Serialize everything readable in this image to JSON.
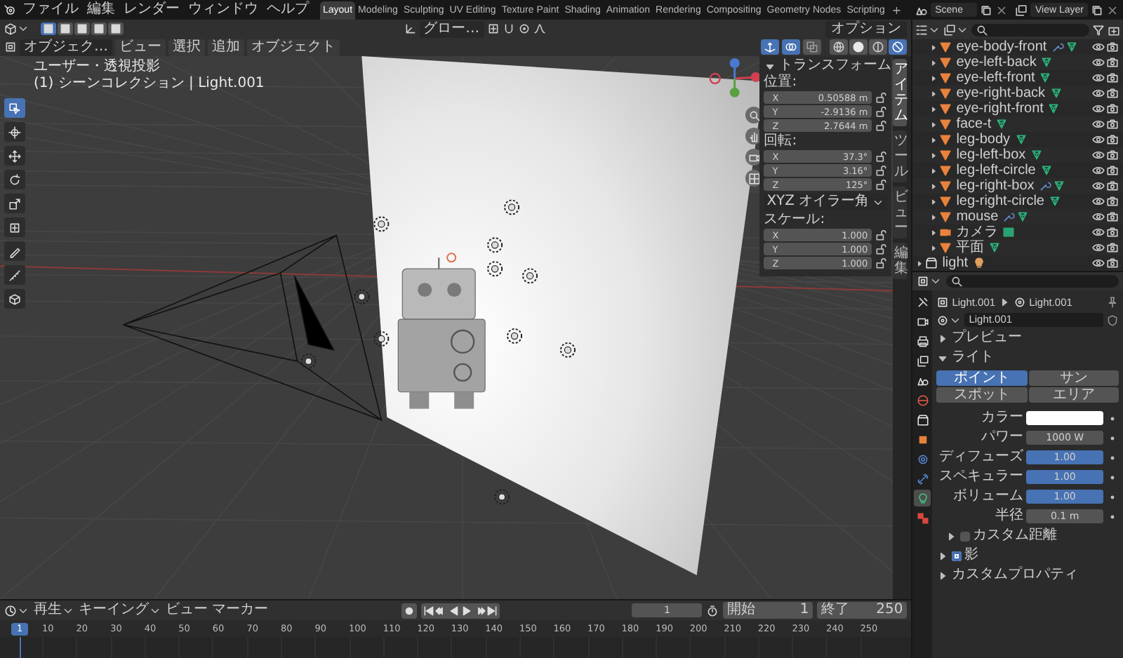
{
  "topbar": {
    "menus": [
      "ファイル",
      "編集",
      "レンダー",
      "ウィンドウ",
      "ヘルプ"
    ],
    "workspaces": [
      {
        "label": "Layout",
        "selected": true
      },
      {
        "label": "Modeling",
        "selected": false
      },
      {
        "label": "Sculpting",
        "selected": false
      },
      {
        "label": "UV Editing",
        "selected": false
      },
      {
        "label": "Texture Paint",
        "selected": false
      },
      {
        "label": "Shading",
        "selected": false
      },
      {
        "label": "Animation",
        "selected": false
      },
      {
        "label": "Rendering",
        "selected": false
      },
      {
        "label": "Compositing",
        "selected": false
      },
      {
        "label": "Geometry Nodes",
        "selected": false
      },
      {
        "label": "Scripting",
        "selected": false
      }
    ],
    "add_workspace": "+",
    "scene": "Scene",
    "view_layer": "View Layer"
  },
  "viewport": {
    "select_modes": [
      {
        "selected": true
      },
      {
        "selected": false
      },
      {
        "selected": false
      },
      {
        "selected": false
      },
      {
        "selected": false
      }
    ],
    "orientation": "グロー…",
    "options": "オプション",
    "mode": "オブジェク…",
    "menus": [
      "ビュー",
      "選択",
      "追加",
      "オブジェクト"
    ],
    "toggles": [
      {
        "kind": "gizmo",
        "on": true
      },
      {
        "kind": "overlay",
        "on": true
      },
      {
        "kind": "xray",
        "on": false
      }
    ],
    "shading": [
      {
        "kind": "wireframe",
        "selected": false
      },
      {
        "kind": "solid",
        "selected": false
      },
      {
        "kind": "material",
        "selected": false
      },
      {
        "kind": "rendered",
        "selected": true
      }
    ],
    "view_name": "ユーザー・透視投影",
    "context": "(1) シーンコレクション | Light.001",
    "tools": [
      {
        "kind": "select",
        "selected": true
      },
      {
        "kind": "cursor",
        "selected": false
      },
      {
        "kind": "move",
        "selected": false
      },
      {
        "kind": "rotate",
        "selected": false
      },
      {
        "kind": "scale",
        "selected": false
      },
      {
        "kind": "transform",
        "selected": false
      },
      {
        "kind": "annotate",
        "selected": false
      },
      {
        "kind": "measure",
        "selected": false
      },
      {
        "kind": "add-cube",
        "selected": false
      }
    ],
    "sidebar_tabs": [
      {
        "label": "アイテム",
        "selected": true
      },
      {
        "label": "ツール",
        "selected": false
      },
      {
        "label": "ビュー",
        "selected": false
      },
      {
        "label": "編集",
        "selected": false
      }
    ],
    "transform": {
      "title": "トランスフォーム",
      "groups": [
        {
          "label": "位置:",
          "fields": [
            {
              "axis": "X",
              "value": "0.50588 m"
            },
            {
              "axis": "Y",
              "value": "-2.9136 m"
            },
            {
              "axis": "Z",
              "value": "2.7644 m"
            }
          ]
        },
        {
          "label": "回転:",
          "fields": [
            {
              "axis": "X",
              "value": "37.3°"
            },
            {
              "axis": "Y",
              "value": "3.16°"
            },
            {
              "axis": "Z",
              "value": "125°"
            }
          ],
          "mode": "XYZ オイラー角"
        },
        {
          "label": "スケール:",
          "fields": [
            {
              "axis": "X",
              "value": "1.000"
            },
            {
              "axis": "Y",
              "value": "1.000"
            },
            {
              "axis": "Z",
              "value": "1.000"
            }
          ]
        }
      ]
    }
  },
  "outliner": {
    "items": [
      {
        "name": "eye-body-front",
        "kind": "mesh",
        "modifier": true,
        "expanded": false
      },
      {
        "name": "eye-left-back",
        "kind": "mesh",
        "modifier": false,
        "expanded": false
      },
      {
        "name": "eye-left-front",
        "kind": "mesh",
        "modifier": false,
        "expanded": false
      },
      {
        "name": "eye-right-back",
        "kind": "mesh",
        "modifier": false,
        "expanded": false
      },
      {
        "name": "eye-right-front",
        "kind": "mesh",
        "modifier": false,
        "expanded": false
      },
      {
        "name": "face-t",
        "kind": "mesh",
        "modifier": false,
        "expanded": false
      },
      {
        "name": "leg-body",
        "kind": "mesh",
        "modifier": false,
        "expanded": false
      },
      {
        "name": "leg-left-box",
        "kind": "mesh",
        "modifier": false,
        "expanded": false
      },
      {
        "name": "leg-left-circle",
        "kind": "mesh",
        "modifier": false,
        "expanded": false
      },
      {
        "name": "leg-right-box",
        "kind": "mesh",
        "modifier": true,
        "expanded": false
      },
      {
        "name": "leg-right-circle",
        "kind": "mesh",
        "modifier": false,
        "expanded": false
      },
      {
        "name": "mouse",
        "kind": "mesh",
        "modifier": true,
        "expanded": false
      },
      {
        "name": "カメラ",
        "kind": "camera",
        "modifier": false,
        "expanded": false
      },
      {
        "name": "平面",
        "kind": "mesh",
        "modifier": false,
        "expanded": false
      }
    ],
    "next_collection": {
      "name": "light",
      "expanded": false
    }
  },
  "properties": {
    "tabs": [
      {
        "kind": "tool",
        "selected": false
      },
      {
        "kind": "render",
        "selected": false
      },
      {
        "kind": "output",
        "selected": false
      },
      {
        "kind": "view-layer",
        "selected": false
      },
      {
        "kind": "scene",
        "selected": false
      },
      {
        "kind": "world",
        "selected": false
      },
      {
        "kind": "collection",
        "selected": false
      },
      {
        "kind": "object",
        "selected": false
      },
      {
        "kind": "physics",
        "selected": false
      },
      {
        "kind": "constraints",
        "selected": false
      },
      {
        "kind": "light-data",
        "selected": true
      },
      {
        "kind": "texture",
        "selected": false
      }
    ],
    "breadcrumb": [
      "Light.001",
      "Light.001"
    ],
    "datablock": "Light.001",
    "preview": {
      "title": "プレビュー",
      "expanded": false
    },
    "light": {
      "title": "ライト",
      "expanded": true,
      "types": [
        {
          "label": "ポイント",
          "selected": true
        },
        {
          "label": "サン",
          "selected": false
        },
        {
          "label": "スポット",
          "selected": false
        },
        {
          "label": "エリア",
          "selected": false
        }
      ],
      "fields": [
        {
          "kind": "color",
          "label": "カラー",
          "color": "#ffffff"
        },
        {
          "kind": "number",
          "label": "パワー",
          "value": "1000 W"
        },
        {
          "kind": "slider",
          "label": "ディフューズ",
          "value": "1.00",
          "level": 1
        },
        {
          "kind": "slider",
          "label": "スペキュラー",
          "value": "1.00",
          "level": 1
        },
        {
          "kind": "slider",
          "label": "ボリューム",
          "value": "1.00",
          "level": 1
        },
        {
          "kind": "number",
          "label": "半径",
          "value": "0.1 m"
        }
      ],
      "custom_distance": {
        "label": "カスタム距離",
        "checked": false,
        "expanded": false
      }
    },
    "shadow": {
      "label": "影",
      "checked": true,
      "expanded": false
    },
    "custom_properties": {
      "title": "カスタムプロパティ",
      "expanded": false
    }
  },
  "timeline": {
    "menus": [
      {
        "label": "再生",
        "dropdown": true
      },
      {
        "label": "キーイング",
        "dropdown": true
      },
      {
        "label": "ビュー",
        "dropdown": false
      },
      {
        "label": "マーカー",
        "dropdown": false
      }
    ],
    "current_frame": "1",
    "start_label": "開始",
    "start": "1",
    "end_label": "終了",
    "end": "250",
    "ruler": [
      {
        "label": "1",
        "selected": true
      },
      {
        "label": "10",
        "selected": false
      },
      {
        "label": "20",
        "selected": false
      },
      {
        "label": "30",
        "selected": false
      },
      {
        "label": "40",
        "selected": false
      },
      {
        "label": "50",
        "selected": false
      },
      {
        "label": "60",
        "selected": false
      },
      {
        "label": "70",
        "selected": false
      },
      {
        "label": "80",
        "selected": false
      },
      {
        "label": "90",
        "selected": false
      },
      {
        "label": "100",
        "selected": false
      },
      {
        "label": "110",
        "selected": false
      },
      {
        "label": "120",
        "selected": false
      },
      {
        "label": "130",
        "selected": false
      },
      {
        "label": "140",
        "selected": false
      },
      {
        "label": "150",
        "selected": false
      },
      {
        "label": "160",
        "selected": false
      },
      {
        "label": "170",
        "selected": false
      },
      {
        "label": "180",
        "selected": false
      },
      {
        "label": "190",
        "selected": false
      },
      {
        "label": "200",
        "selected": false
      },
      {
        "label": "210",
        "selected": false
      },
      {
        "label": "220",
        "selected": false
      },
      {
        "label": "230",
        "selected": false
      },
      {
        "label": "240",
        "selected": false
      },
      {
        "label": "250",
        "selected": false
      }
    ]
  }
}
